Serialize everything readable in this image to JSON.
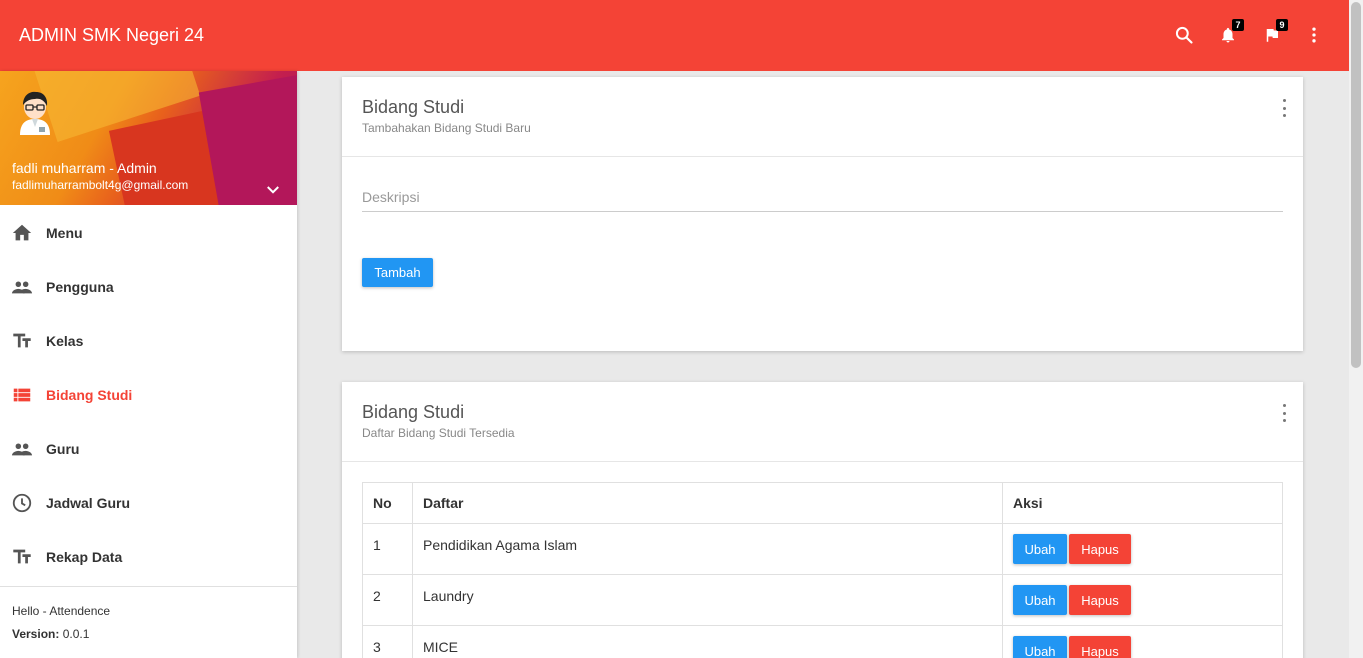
{
  "topbar": {
    "brand": "ADMIN SMK Negeri 24",
    "notifications_count": "7",
    "flags_count": "9",
    "icons": [
      "search-icon",
      "bell-icon",
      "flag-icon",
      "more-vert-icon"
    ],
    "color": "#f44336"
  },
  "sidebar": {
    "user_name": "fadli muharram - Admin",
    "user_email": "fadlimuharrambolt4g@gmail.com",
    "items": [
      {
        "label": "Menu",
        "icon": "home-icon",
        "active": false
      },
      {
        "label": "Pengguna",
        "icon": "people-icon",
        "active": false
      },
      {
        "label": "Kelas",
        "icon": "text-fields-icon",
        "active": false
      },
      {
        "label": "Bidang Studi",
        "icon": "view-list-icon",
        "active": true
      },
      {
        "label": "Guru",
        "icon": "people-icon",
        "active": false
      },
      {
        "label": "Jadwal Guru",
        "icon": "clock-icon",
        "active": false
      },
      {
        "label": "Rekap Data",
        "icon": "text-fields-icon",
        "active": false
      }
    ],
    "footer_line1": "Hello - Attendence",
    "version_label": "Version:",
    "version_value": " 0.0.1",
    "active_color": "#f44336"
  },
  "form_card": {
    "title": "Bidang Studi",
    "subtitle": "Tambahakan Bidang Studi Baru",
    "input_placeholder": "Deskripsi",
    "input_value": "",
    "submit_label": "Tambah"
  },
  "list_card": {
    "title": "Bidang Studi",
    "subtitle": "Daftar Bidang Studi Tersedia",
    "columns": [
      "No",
      "Daftar",
      "Aksi"
    ],
    "rows": [
      {
        "no": "1",
        "name": "Pendidikan Agama Islam",
        "edit": "Ubah",
        "delete": "Hapus"
      },
      {
        "no": "2",
        "name": "Laundry",
        "edit": "Ubah",
        "delete": "Hapus"
      },
      {
        "no": "3",
        "name": "MICE",
        "edit": "Ubah",
        "delete": "Hapus"
      }
    ]
  },
  "colors": {
    "primary": "#2196f3",
    "danger": "#f44336"
  }
}
